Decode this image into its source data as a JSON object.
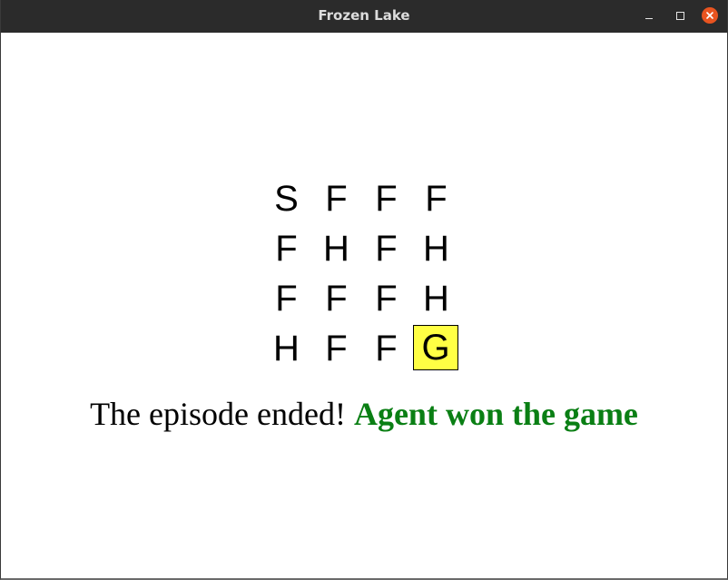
{
  "window": {
    "title": "Frozen Lake",
    "controls": {
      "minimize_icon": "minimize-icon",
      "maximize_icon": "maximize-icon",
      "close_icon": "close-icon",
      "close_color": "#e95420"
    }
  },
  "board": {
    "rows": [
      [
        "S",
        "F",
        "F",
        "F"
      ],
      [
        "F",
        "H",
        "F",
        "H"
      ],
      [
        "F",
        "F",
        "F",
        "H"
      ],
      [
        "H",
        "F",
        "F",
        "G"
      ]
    ],
    "agent_row": 3,
    "agent_col": 3,
    "agent_highlight_color": "#ffff44"
  },
  "status": {
    "prefix": "The episode ended!",
    "result": "Agent won the game",
    "result_color": "#0a7f14"
  }
}
